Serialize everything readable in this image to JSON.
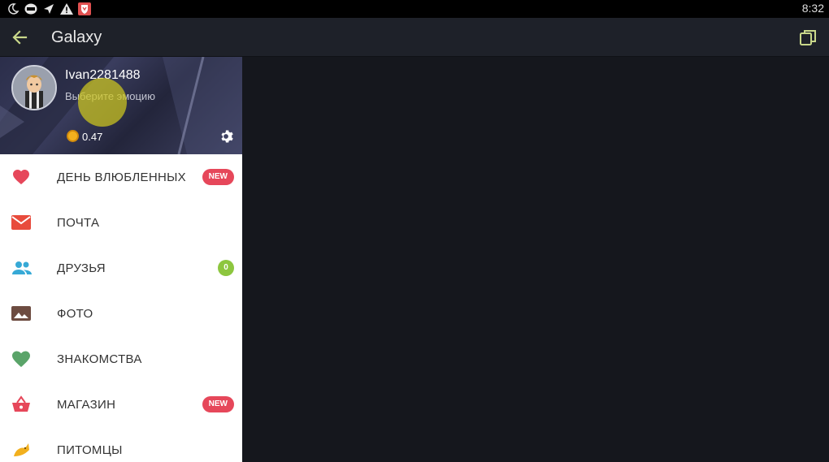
{
  "status_bar": {
    "icons": [
      "moon-icon",
      "app-badge-icon",
      "send-icon",
      "warning-icon",
      "shield-icon"
    ],
    "time": "8:32"
  },
  "app_bar": {
    "title": "Galaxy"
  },
  "profile": {
    "username": "Ivan2281488",
    "emotion_placeholder": "Выберите эмоцию",
    "coins": "0.47"
  },
  "menu": [
    {
      "label": "ДЕНЬ ВЛЮБЛЕННЫХ",
      "icon": "heart-icon",
      "badge": "NEW"
    },
    {
      "label": "ПОЧТА",
      "icon": "mail-icon"
    },
    {
      "label": "ДРУЗЬЯ",
      "icon": "friends-icon",
      "count": "0"
    },
    {
      "label": "ФОТО",
      "icon": "photo-icon"
    },
    {
      "label": "ЗНАКОМСТВА",
      "icon": "green-heart-icon"
    },
    {
      "label": "МАГАЗИН",
      "icon": "basket-icon",
      "badge": "NEW"
    },
    {
      "label": "ПИТОМЦЫ",
      "icon": "pet-icon"
    }
  ],
  "colors": {
    "accent_green": "#8dc63f",
    "badge_red": "#e6475a",
    "app_bar": "#1e2129",
    "content_bg": "#15171d"
  }
}
